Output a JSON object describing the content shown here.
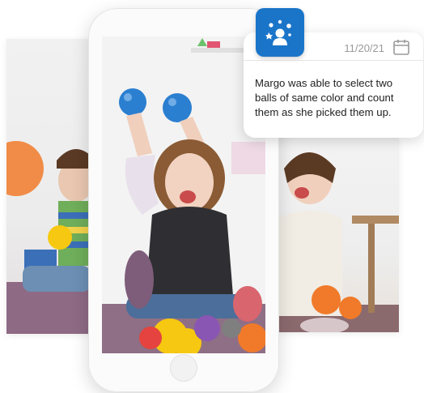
{
  "notification": {
    "date": "11/20/21",
    "message": "Margo was able to select two balls of same color and count them as she picked them up.",
    "icon": "calendar-icon"
  },
  "app_badge": {
    "icon": "child-activity-icon",
    "color": "#1a75c9"
  },
  "photos": [
    {
      "name": "photo-left",
      "subject": "child holding yellow and orange balls"
    },
    {
      "name": "phone-photo",
      "subject": "girl tossing blue balls in a ball pit"
    },
    {
      "name": "photo-right",
      "subject": "smiling girl in white sweater"
    }
  ],
  "colors": {
    "accent": "#1a75c9",
    "ball_blue": "#2b7fd0",
    "ball_orange": "#f07a2a",
    "ball_yellow": "#f6c811"
  }
}
